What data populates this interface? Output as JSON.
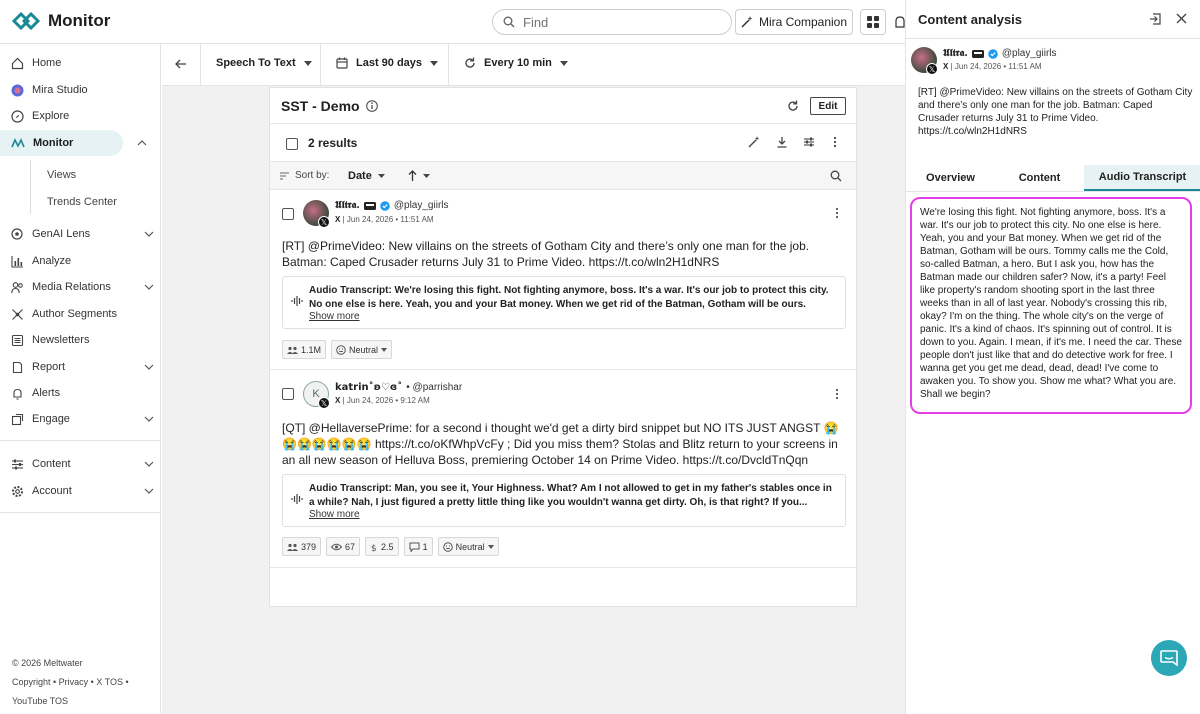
{
  "app": {
    "brand": "Monitor"
  },
  "topbar": {
    "search_placeholder": "Find",
    "mira_companion_label": "Mira Companion"
  },
  "sidebar": {
    "items": [
      {
        "label": "Home",
        "icon": "home-icon"
      },
      {
        "label": "Mira Studio",
        "icon": "mira-studio-icon"
      },
      {
        "label": "Explore",
        "icon": "compass-icon"
      },
      {
        "label": "Monitor",
        "icon": "monitor-icon",
        "active": true
      },
      {
        "label": "GenAI Lens",
        "icon": "genai-lens-icon"
      },
      {
        "label": "Analyze",
        "icon": "bar-chart-icon"
      },
      {
        "label": "Media Relations",
        "icon": "people-icon"
      },
      {
        "label": "Author Segments",
        "icon": "network-icon"
      },
      {
        "label": "Newsletters",
        "icon": "newsletter-icon"
      },
      {
        "label": "Report",
        "icon": "report-icon"
      },
      {
        "label": "Alerts",
        "icon": "bell-icon"
      },
      {
        "label": "Engage",
        "icon": "engage-icon"
      },
      {
        "label": "Content",
        "icon": "sliders-icon"
      },
      {
        "label": "Account",
        "icon": "gear-icon"
      }
    ],
    "sub_items": [
      "Views",
      "Trends Center"
    ],
    "footer": {
      "copyright": "© 2026 Meltwater",
      "links": "Copyright • Privacy • X TOS •",
      "youtube": "YouTube TOS"
    }
  },
  "toolbar": {
    "filter1": "Speech To Text",
    "filter2": "Last 90 days",
    "filter3": "Every 10 min"
  },
  "feed": {
    "title": "SST - Demo",
    "edit_label": "Edit",
    "results": "2 results",
    "sort_by_label": "Sort by:",
    "sort_value": "Date",
    "posts": [
      {
        "name": "𝖀𝖑𝖙𝖗𝖆.",
        "handle": "@play_giirls",
        "source": "X",
        "date": "| Jun 24, 2026 • 11:51 AM",
        "text": "[RT] @PrimeVideo: New villains on the streets of Gotham City and there’s only one man for the job. Batman: Caped Crusader returns July 31 to Prime Video. https://t.co/wln2H1dNRS",
        "transcript": "Audio Transcript: We're losing this fight. Not fighting anymore, boss. It's a war. It's our job to protect this city. No one else is here. Yeah, you and your Bat money. When we get rid of the Batman, Gotham will be ours.",
        "show_more": "Show more",
        "reach": "1.1M",
        "sentiment": "Neutral"
      },
      {
        "name": "katrin˚ʚ♡ɞ˚",
        "handle": "• @parrishar",
        "avatar_letter": "K",
        "source": "X",
        "date": "| Jun 24, 2026 • 9:12 AM",
        "text": "[QT] @HellaversePrime: for a second i thought we'd get a dirty bird snippet but NO ITS JUST ANGST 😭😭😭😭😭😭😭 https://t.co/oKfWhpVcFy ; Did you miss them? Stolas and Blitz return to your screens in an all new season of Helluva Boss, premiering October 14 on Prime Video. https://t.co/DvcldTnQqn",
        "transcript": "Audio Transcript: Man, you see it, Your Highness. What? Am I not allowed to get in my father's stables once in a while? Nah, I just figured a pretty little thing like you wouldn't wanna get dirty. Oh, is that right? If you...",
        "show_more": "Show more",
        "reach": "379",
        "views": "67",
        "value": "2.5",
        "comments": "1",
        "sentiment": "Neutral"
      }
    ]
  },
  "panel": {
    "title": "Content analysis",
    "author_name": "𝖀𝖑𝖙𝖗𝖆.",
    "author_handle": "@play_giirls",
    "author_meta": "| Jun 24, 2026 • 11:51 AM",
    "source": "X",
    "text": "[RT] @PrimeVideo: New villains on the streets of Gotham City and there’s only one man for the job. Batman: Caped Crusader returns July 31 to Prime Video. https://t.co/wln2H1dNRS",
    "tabs": [
      "Overview",
      "Content",
      "Audio Transcript"
    ],
    "transcript": "We're losing this fight. Not fighting anymore, boss. It's a war. It's our job to protect this city. No one else is here. Yeah, you and your Bat money. When we get rid of the Batman, Gotham will be ours. Tommy calls me the Cold, so-called Batman, a hero. But I ask you, how has the Batman made our children safer? Now, it's a party! Feel like property's random shooting sport in the last three weeks than in all of last year. Nobody's crossing this rib, okay? I'm on the thing. The whole city's on the verge of panic. It's a kind of chaos. It's spinning out of control. It is down to you. Again. I mean, if it's me. I need the car. These people don't just like that and do detective work for free. I wanna get you get me dead, dead, dead! I've come to awaken you. To show you. Show me what? What you are. Shall we begin?"
  },
  "colors": {
    "accent": "#1a8a95",
    "highlight": "#e43fe6",
    "active_bg": "#e6f2f3",
    "fab": "#2ba7b5"
  }
}
